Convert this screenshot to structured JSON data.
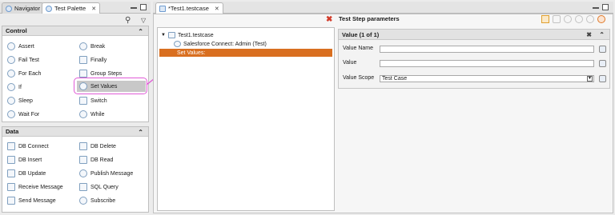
{
  "left_tabs": {
    "navigator": "Navigator",
    "palette": "Test Palette"
  },
  "sections": {
    "control": {
      "title": "Control",
      "items": [
        "Assert",
        "Break",
        "Fail Test",
        "Finally",
        "For Each",
        "Group Steps",
        "If",
        "Set Values",
        "Sleep",
        "Switch",
        "Wait For",
        "While"
      ]
    },
    "data": {
      "title": "Data",
      "items": [
        "DB Connect",
        "DB Delete",
        "DB Insert",
        "DB Read",
        "DB Update",
        "Publish Message",
        "Receive Message",
        "SQL Query",
        "Send Message",
        "Subscribe"
      ]
    }
  },
  "editor": {
    "tab": "*Test1.testcase",
    "tree": {
      "root": "Test1.testcase",
      "child1": "Salesforce Connect: Admin (Test)",
      "child2": "Set Values:"
    }
  },
  "params": {
    "title": "Test Step parameters",
    "panel_title": "Value (1 of 1)",
    "value_name_label": "Value Name",
    "value_label": "Value",
    "scope_label": "Value Scope",
    "scope_value": "Test Case"
  },
  "colors": {
    "selection": "#d96f20",
    "highlight": "#e05ad6"
  }
}
